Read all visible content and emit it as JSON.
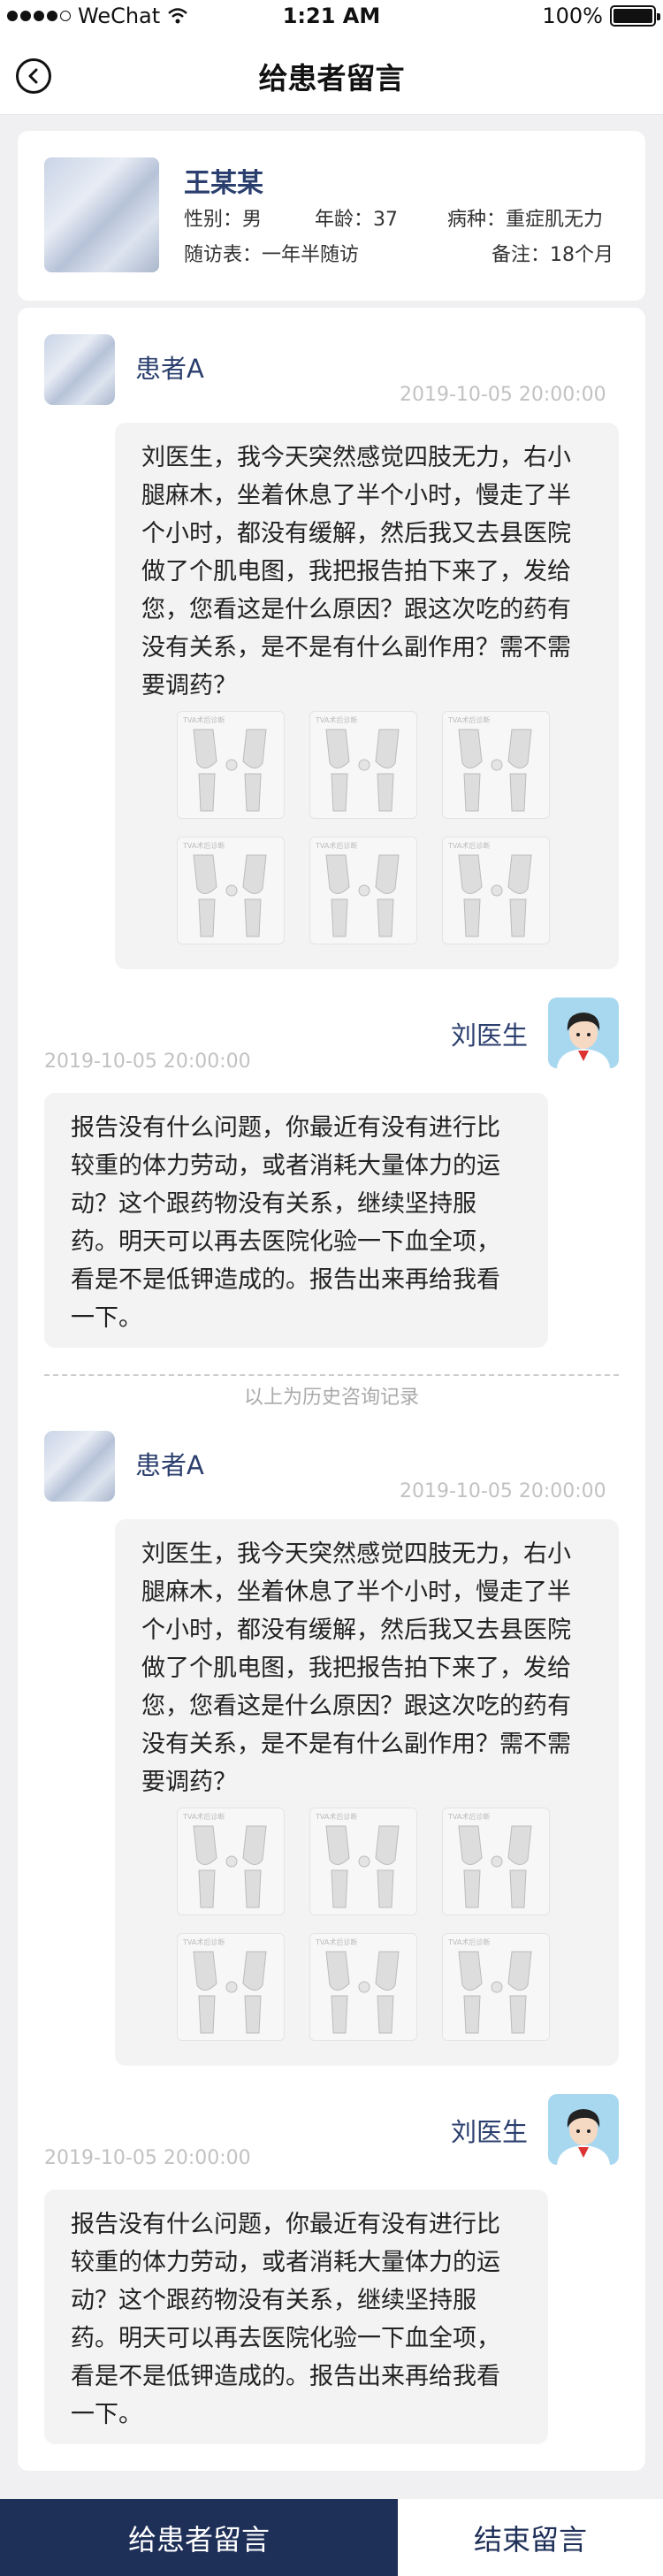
{
  "status_bar": {
    "carrier": "WeChat",
    "time": "1:21 AM",
    "battery": "100%"
  },
  "nav": {
    "title": "给患者留言"
  },
  "patient": {
    "name": "王某某",
    "gender": "性别：男",
    "age": "年龄：37",
    "disease": "病种：重症肌无力",
    "followup": "随访表：一年半随访",
    "remark": "备注：18个月"
  },
  "conversation": {
    "history_divider": "以上为历史咨询记录",
    "blocks": [
      {
        "patient_name": "患者A",
        "patient_time": "2019-10-05   20:00:00",
        "patient_message": "刘医生，我今天突然感觉四肢无力，右小腿麻木，坐着休息了半个小时，慢走了半个小时，都没有缓解，然后我又去县医院做了个肌电图，我把报告拍下来了，发给您，您看这是什么原因？跟这次吃的药有没有关系，是不是有什么副作用？需不需要调药？",
        "image_caption": "TVA术后诊断",
        "doctor_name": "刘医生",
        "doctor_time": "2019-10-05   20:00:00",
        "doctor_message": "报告没有什么问题，你最近有没有进行比较重的体力劳动，或者消耗大量体力的运动？这个跟药物没有关系，继续坚持服药。明天可以再去医院化验一下血全项，看是不是低钾造成的。报告出来再给我看一下。"
      },
      {
        "patient_name": "患者A",
        "patient_time": "2019-10-05   20:00:00",
        "patient_message": "刘医生，我今天突然感觉四肢无力，右小腿麻木，坐着休息了半个小时，慢走了半个小时，都没有缓解，然后我又去县医院做了个肌电图，我把报告拍下来了，发给您，您看这是什么原因？跟这次吃的药有没有关系，是不是有什么副作用？需不需要调药？",
        "image_caption": "TVA术后诊断",
        "doctor_name": "刘医生",
        "doctor_time": "2019-10-05   20:00:00",
        "doctor_message": "报告没有什么问题，你最近有没有进行比较重的体力劳动，或者消耗大量体力的运动？这个跟药物没有关系，继续坚持服药。明天可以再去医院化验一下血全项，看是不是低钾造成的。报告出来再给我看一下。"
      }
    ]
  },
  "bottom_bar": {
    "primary_label": "给患者留言",
    "secondary_label": "结束留言"
  },
  "colors": {
    "brand": "#1e2f58",
    "name_text": "#2b3f6e",
    "timestamp": "#c2c2c2"
  }
}
